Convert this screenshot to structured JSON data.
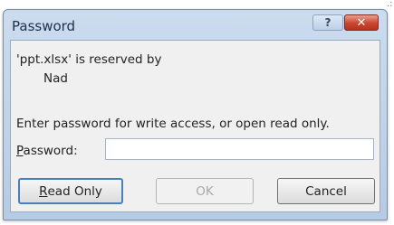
{
  "corner_mark": ".:",
  "dialog": {
    "title": "Password",
    "help_label": "?",
    "close_label": "✕",
    "message": {
      "line1": "'ppt.xlsx' is reserved by",
      "line2": "Nad",
      "line3": "Enter password for write access, or open read only."
    },
    "password": {
      "label_accel": "P",
      "label_rest": "assword:",
      "value": ""
    },
    "buttons": {
      "read_only_accel": "R",
      "read_only_rest": "ead Only",
      "ok": "OK",
      "cancel": "Cancel"
    }
  }
}
